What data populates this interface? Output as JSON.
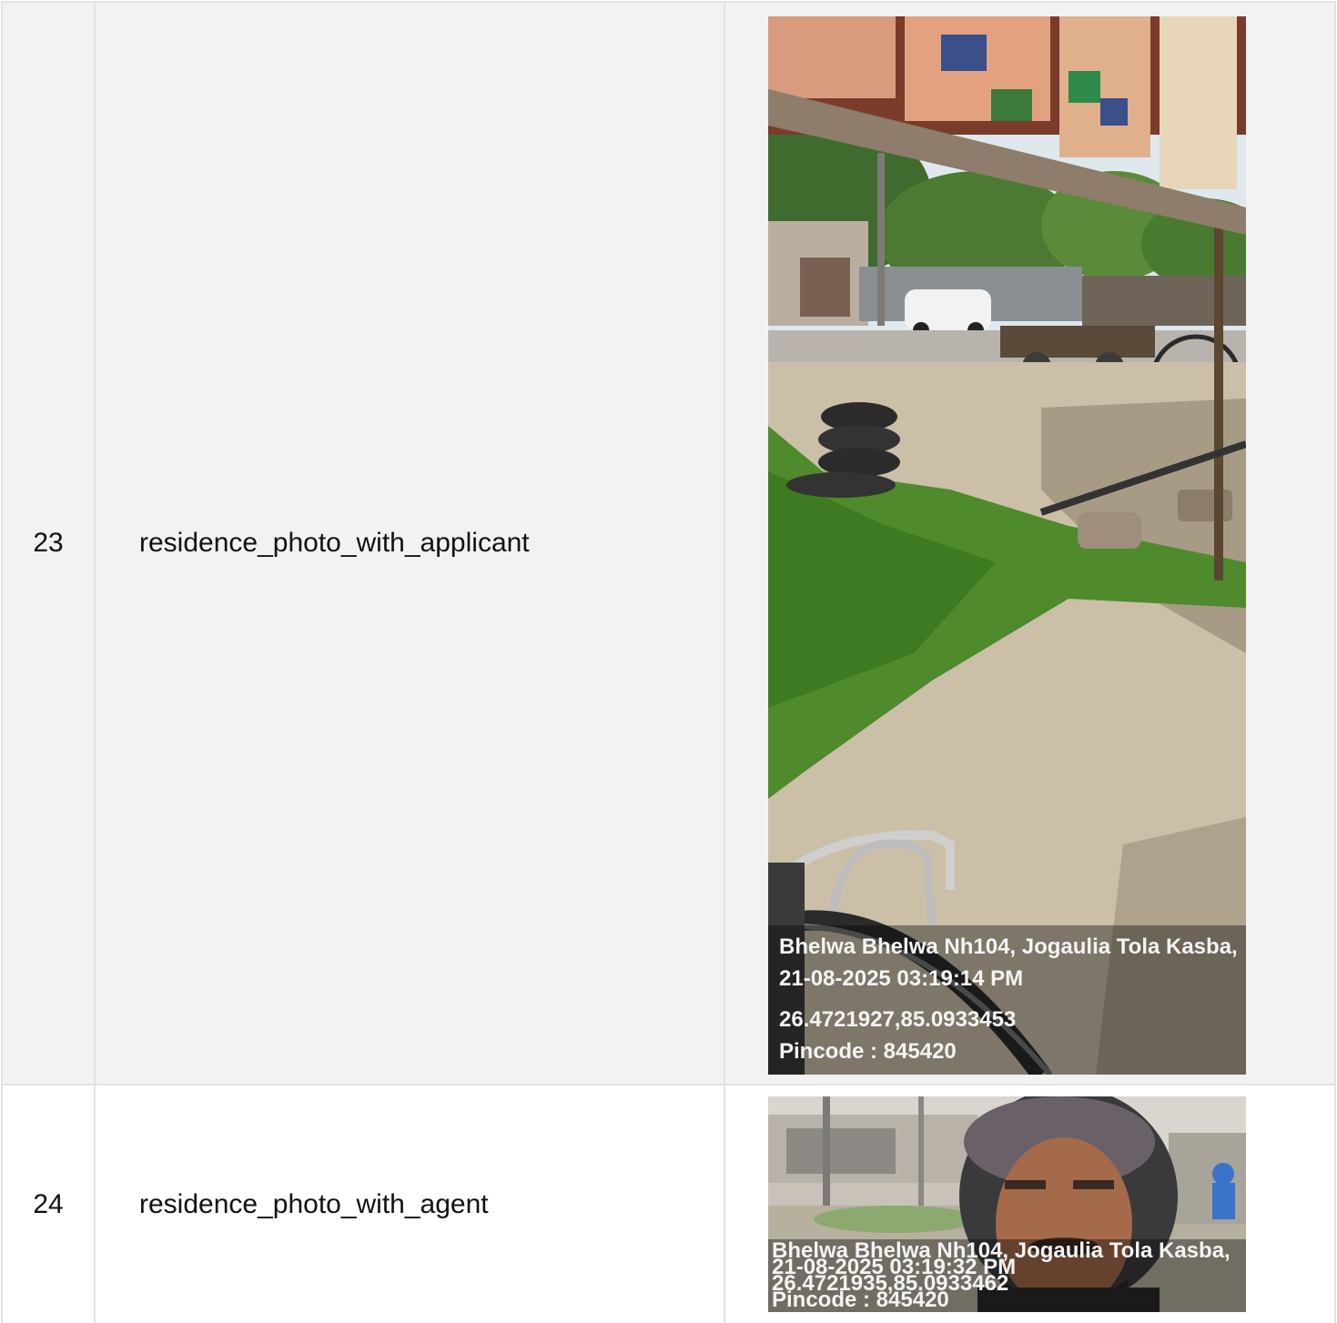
{
  "rows": [
    {
      "sn": "23",
      "name": "residence_photo_with_applicant",
      "photo": {
        "line1": "Bhelwa Bhelwa Nh104, Jogaulia Tola Kasba,",
        "line2": "21-08-2025 03:19:14 PM",
        "line3": "26.4721927,85.0933453",
        "line4": "Pincode : 845420"
      }
    },
    {
      "sn": "24",
      "name": "residence_photo_with_agent",
      "photo": {
        "line1": "Bhelwa Bhelwa Nh104, Jogaulia Tola Kasba,",
        "line2": "21-08-2025 03:19:32 PM",
        "line3": "26.4721935,85.0933462",
        "line4": "Pincode : 845420"
      }
    }
  ]
}
